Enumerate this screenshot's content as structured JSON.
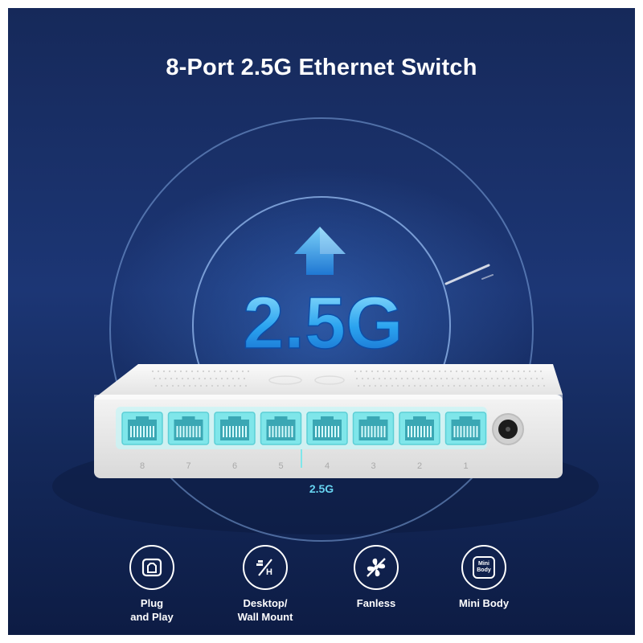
{
  "title": "8-Port 2.5G Ethernet Switch",
  "badge": "2.5G",
  "port_speed_label": "2.5G",
  "port_numbers": [
    "8",
    "7",
    "6",
    "5",
    "4",
    "3",
    "2",
    "1"
  ],
  "features": [
    {
      "icon": "plug-and-play-icon",
      "label": "Plug\nand Play"
    },
    {
      "icon": "desktop-wall-mount-icon",
      "label": "Desktop/\nWall Mount"
    },
    {
      "icon": "fan-icon",
      "label": "Fanless"
    },
    {
      "icon": "mini-body-icon",
      "label": "Mini Body"
    }
  ],
  "mini_icon_text": "Mini\nBody",
  "colors": {
    "background": "#1c3675",
    "accent": "#3fb8f0",
    "port_glow": "#7fe6ea",
    "device": "#eeeeee"
  }
}
